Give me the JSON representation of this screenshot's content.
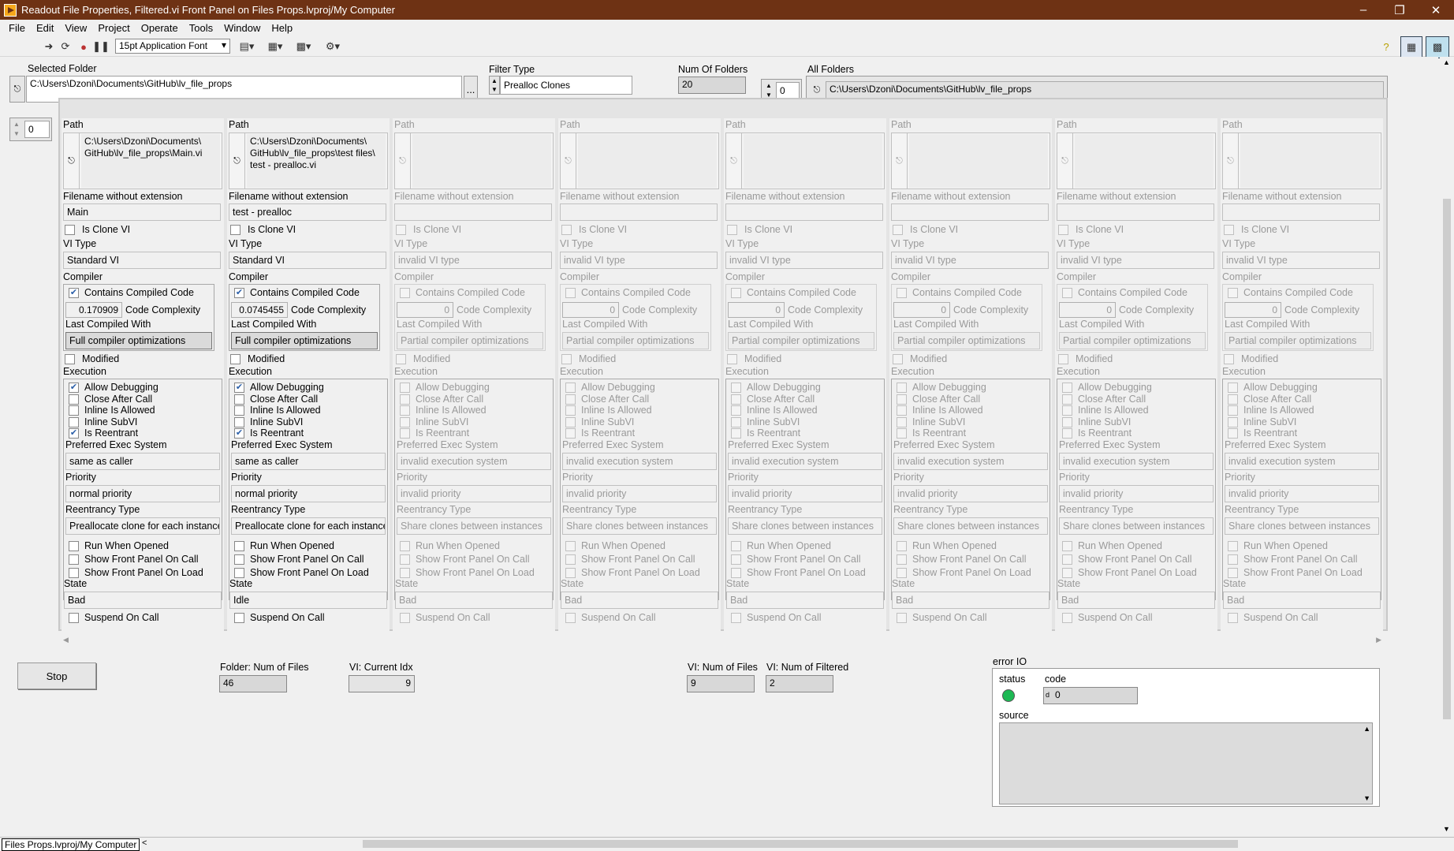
{
  "window": {
    "title": "Readout File Properties, Filtered.vi Front Panel on Files Props.lvproj/My Computer"
  },
  "menu": [
    "File",
    "Edit",
    "View",
    "Project",
    "Operate",
    "Tools",
    "Window",
    "Help"
  ],
  "toolbar": {
    "font": "15pt Application Font"
  },
  "top": {
    "selected_folder_label": "Selected Folder",
    "selected_folder_value": "C:\\Users\\Dzoni\\Documents\\GitHub\\lv_file_props",
    "browse_label": "...",
    "filter_type_label": "Filter Type",
    "filter_type_value": "Prealloc Clones",
    "num_folders_label": "Num Of Folders",
    "num_folders_value": "20",
    "all_folders_index": "0",
    "all_folders_label": "All Folders",
    "all_folders_value": "C:\\Users\\Dzoni\\Documents\\GitHub\\lv_file_props"
  },
  "array_index": "0",
  "labels": {
    "path": "Path",
    "filename": "Filename without extension",
    "is_clone": "Is Clone VI",
    "vi_type": "VI Type",
    "compiler": "Compiler",
    "contains_compiled": "Contains Compiled Code",
    "code_complexity": "Code Complexity",
    "last_compiled": "Last Compiled With",
    "modified": "Modified",
    "execution": "Execution",
    "allow_debugging": "Allow Debugging",
    "close_after_call": "Close After Call",
    "inline_allowed": "Inline Is Allowed",
    "inline_subvi": "Inline SubVI",
    "is_reentrant": "Is Reentrant",
    "pref_exec": "Preferred Exec System",
    "priority": "Priority",
    "reentrancy_type": "Reentrancy Type",
    "run_when_opened": "Run When Opened",
    "show_fp_on_call": "Show Front Panel On Call",
    "show_fp_on_load": "Show Front Panel On Load",
    "state": "State",
    "suspend_on_call": "Suspend On Call"
  },
  "columns": [
    {
      "enabled": true,
      "path": "C:\\Users\\Dzoni\\Documents\\\nGitHub\\lv_file_props\\Main.vi",
      "filename": "Main",
      "is_clone": false,
      "vi_type": "Standard VI",
      "contains_compiled": true,
      "complexity": "0.170909",
      "last_compiled": "Full compiler optimizations",
      "modified": false,
      "allow_debugging": true,
      "close_after_call": false,
      "inline_allowed": false,
      "inline_subvi": false,
      "is_reentrant": true,
      "pref_exec": "same as caller",
      "priority": "normal priority",
      "reentrancy": "Preallocate clone for each instance",
      "run_when_opened": false,
      "show_fp_on_call": false,
      "show_fp_on_load": false,
      "state": "Bad",
      "suspend_on_call": false
    },
    {
      "enabled": true,
      "path": "C:\\Users\\Dzoni\\Documents\\\nGitHub\\lv_file_props\\test files\\\ntest - prealloc.vi",
      "filename": "test - prealloc",
      "is_clone": false,
      "vi_type": "Standard VI",
      "contains_compiled": true,
      "complexity": "0.0745455",
      "last_compiled": "Full compiler optimizations",
      "modified": false,
      "allow_debugging": true,
      "close_after_call": false,
      "inline_allowed": false,
      "inline_subvi": false,
      "is_reentrant": true,
      "pref_exec": "same as caller",
      "priority": "normal priority",
      "reentrancy": "Preallocate clone for each instance",
      "run_when_opened": false,
      "show_fp_on_call": false,
      "show_fp_on_load": false,
      "state": "Idle",
      "suspend_on_call": false
    },
    {
      "enabled": false,
      "path": "",
      "filename": "",
      "is_clone": false,
      "vi_type": "invalid VI type",
      "contains_compiled": false,
      "complexity": "0",
      "last_compiled": "Partial compiler optimizations",
      "modified": false,
      "allow_debugging": false,
      "close_after_call": false,
      "inline_allowed": false,
      "inline_subvi": false,
      "is_reentrant": false,
      "pref_exec": "invalid execution system",
      "priority": "invalid priority",
      "reentrancy": "Share clones between instances",
      "run_when_opened": false,
      "show_fp_on_call": false,
      "show_fp_on_load": false,
      "state": "Bad",
      "suspend_on_call": false
    },
    {
      "enabled": false,
      "path": "",
      "filename": "",
      "is_clone": false,
      "vi_type": "invalid VI type",
      "contains_compiled": false,
      "complexity": "0",
      "last_compiled": "Partial compiler optimizations",
      "modified": false,
      "allow_debugging": false,
      "close_after_call": false,
      "inline_allowed": false,
      "inline_subvi": false,
      "is_reentrant": false,
      "pref_exec": "invalid execution system",
      "priority": "invalid priority",
      "reentrancy": "Share clones between instances",
      "run_when_opened": false,
      "show_fp_on_call": false,
      "show_fp_on_load": false,
      "state": "Bad",
      "suspend_on_call": false
    },
    {
      "enabled": false,
      "path": "",
      "filename": "",
      "is_clone": false,
      "vi_type": "invalid VI type",
      "contains_compiled": false,
      "complexity": "0",
      "last_compiled": "Partial compiler optimizations",
      "modified": false,
      "allow_debugging": false,
      "close_after_call": false,
      "inline_allowed": false,
      "inline_subvi": false,
      "is_reentrant": false,
      "pref_exec": "invalid execution system",
      "priority": "invalid priority",
      "reentrancy": "Share clones between instances",
      "run_when_opened": false,
      "show_fp_on_call": false,
      "show_fp_on_load": false,
      "state": "Bad",
      "suspend_on_call": false
    },
    {
      "enabled": false,
      "path": "",
      "filename": "",
      "is_clone": false,
      "vi_type": "invalid VI type",
      "contains_compiled": false,
      "complexity": "0",
      "last_compiled": "Partial compiler optimizations",
      "modified": false,
      "allow_debugging": false,
      "close_after_call": false,
      "inline_allowed": false,
      "inline_subvi": false,
      "is_reentrant": false,
      "pref_exec": "invalid execution system",
      "priority": "invalid priority",
      "reentrancy": "Share clones between instances",
      "run_when_opened": false,
      "show_fp_on_call": false,
      "show_fp_on_load": false,
      "state": "Bad",
      "suspend_on_call": false
    },
    {
      "enabled": false,
      "path": "",
      "filename": "",
      "is_clone": false,
      "vi_type": "invalid VI type",
      "contains_compiled": false,
      "complexity": "0",
      "last_compiled": "Partial compiler optimizations",
      "modified": false,
      "allow_debugging": false,
      "close_after_call": false,
      "inline_allowed": false,
      "inline_subvi": false,
      "is_reentrant": false,
      "pref_exec": "invalid execution system",
      "priority": "invalid priority",
      "reentrancy": "Share clones between instances",
      "run_when_opened": false,
      "show_fp_on_call": false,
      "show_fp_on_load": false,
      "state": "Bad",
      "suspend_on_call": false
    },
    {
      "enabled": false,
      "path": "",
      "filename": "",
      "is_clone": false,
      "vi_type": "invalid VI type",
      "contains_compiled": false,
      "complexity": "0",
      "last_compiled": "Partial compiler optimizations",
      "modified": false,
      "allow_debugging": false,
      "close_after_call": false,
      "inline_allowed": false,
      "inline_subvi": false,
      "is_reentrant": false,
      "pref_exec": "invalid execution system",
      "priority": "invalid priority",
      "reentrancy": "Share clones between instances",
      "run_when_opened": false,
      "show_fp_on_call": false,
      "show_fp_on_load": false,
      "state": "Bad",
      "suspend_on_call": false
    }
  ],
  "bottom": {
    "stop_label": "Stop",
    "folder_num_files_label": "Folder: Num of Files",
    "folder_num_files_value": "46",
    "vi_current_idx_label": "VI: Current Idx",
    "vi_current_idx_value": "9",
    "vi_num_files_label": "VI: Num of Files",
    "vi_num_files_value": "9",
    "vi_num_filtered_label": "VI: Num of Filtered",
    "vi_num_filtered_value": "2"
  },
  "error_io": {
    "label": "error IO",
    "status_label": "status",
    "code_label": "code",
    "code_prefix": "d",
    "code_value": "0",
    "source_label": "source",
    "status_color": "#1db954"
  },
  "statusbar": {
    "project": "Files Props.lvproj/My Computer"
  }
}
